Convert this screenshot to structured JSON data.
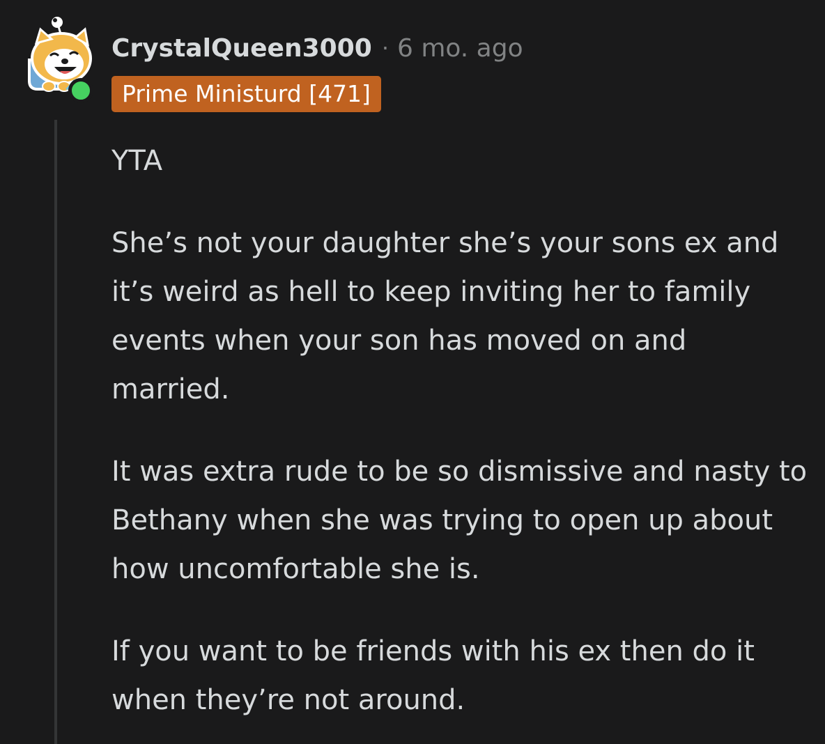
{
  "comment": {
    "username": "CrystalQueen3000",
    "separator": "·",
    "timestamp": "6 mo. ago",
    "flair": "Prime Ministurd [471]",
    "paragraphs": [
      "YTA",
      "She’s not your daughter she’s your sons ex and it’s weird as hell to keep inviting her to family events when your son has moved on and married.",
      "It was extra rude to be so dismissive and nasty to Bethany when she was trying to open up about how uncomfortable she is.",
      "If you want to be friends with his ex then do it when they’re not around."
    ]
  },
  "colors": {
    "background": "#1a1a1b",
    "text": "#d7dadc",
    "muted": "#818384",
    "flair_bg": "#c06220",
    "online": "#46d160"
  },
  "icons": {
    "avatar": "doge-snoo-avatar",
    "status": "online-status-dot"
  }
}
